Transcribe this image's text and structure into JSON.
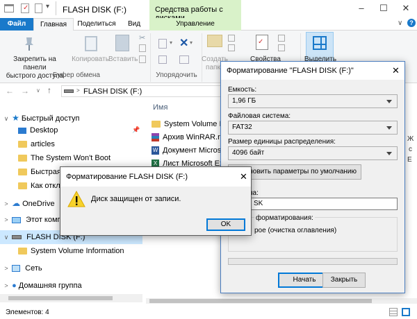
{
  "window": {
    "title": "FLASH DISK (F:)",
    "context_header": "Средства работы с дисками"
  },
  "tabs": {
    "file": "Файл",
    "home": "Главная",
    "share": "Поделиться",
    "view": "Вид",
    "manage": "Управление"
  },
  "ribbon": {
    "pin_label_1": "Закрепить на панели",
    "pin_label_2": "быстрого доступа",
    "copy": "Копировать",
    "paste": "Вставить",
    "clipboard_group": "Буфер обмена",
    "organize_group": "Упорядочить",
    "create_1": "Создать",
    "create_2": "папку",
    "properties": "Свойства",
    "select": "Выделить"
  },
  "address": {
    "path": "FLASH DISK (F:)"
  },
  "nav": {
    "quick_access": "Быстрый доступ",
    "items": [
      "Desktop",
      "articles",
      "The System Won't Boot",
      "Быстрая",
      "Как откл"
    ],
    "onedrive": "OneDrive",
    "this_pc": "Этот компь",
    "flash": "FLASH DISK (F:)",
    "svi": "System Volume Information",
    "network": "Сеть",
    "homegroup": "Домашняя группа"
  },
  "files": {
    "column_name": "Имя",
    "items": [
      "System Volume Infor",
      "Архив WinRAR.rar",
      "Документ Microsof",
      "Лист Microsoft Exce"
    ]
  },
  "status": {
    "items_count": "Элементов: 4"
  },
  "format_dialog": {
    "title": "Форматирование \"FLASH DISK (F:)\"",
    "capacity_label": "Емкость:",
    "capacity_value": "1,96 ГБ",
    "fs_label": "Файловая система:",
    "fs_value": "FAT32",
    "alloc_label": "Размер единицы распределения:",
    "alloc_value": "4096 байт",
    "defaults_button": "ановить параметры по умолчанию",
    "volume_label_partial": "на:",
    "volume_value_partial": "SK",
    "format_opts_label": "форматирования:",
    "quick_format_partial": "рое (очистка оглавления)",
    "start_button": "Начать",
    "close_button": "Закрыть",
    "progress": 0
  },
  "error_dialog": {
    "title": "Форматирование FLASH DISK (F:)",
    "message": "Диск защищен от записи.",
    "ok_button": "OK"
  },
  "right_edge_partial": {
    "r1": "Ж",
    "r2": "с",
    "r3": "Е"
  }
}
